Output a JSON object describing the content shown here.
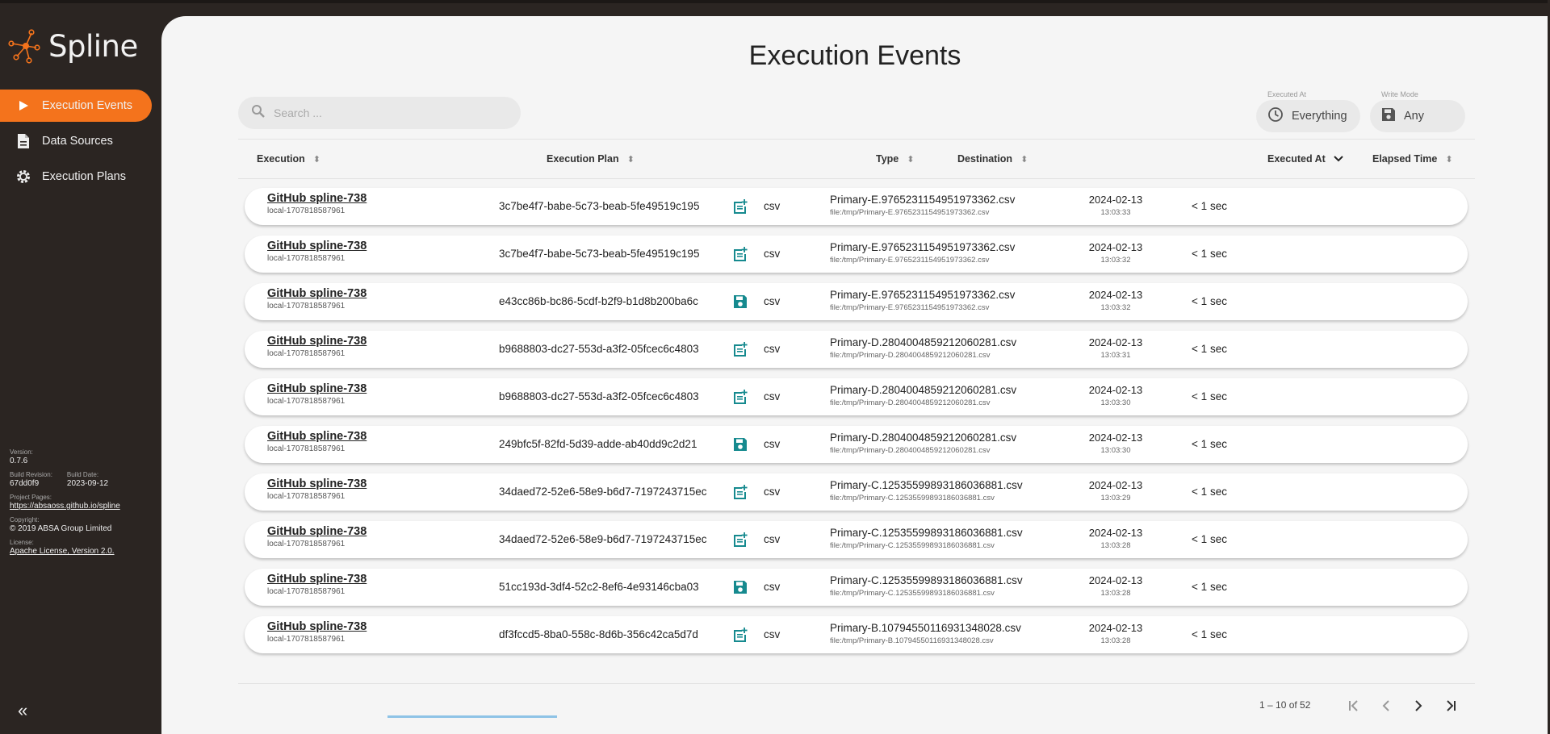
{
  "app": {
    "name": "Spline"
  },
  "colors": {
    "accent": "#f4731c",
    "sidebar": "#2b2522",
    "teal": "#168a8f"
  },
  "nav": [
    {
      "label": "Execution Events",
      "icon": "play-icon",
      "active": true
    },
    {
      "label": "Data Sources",
      "icon": "document-icon",
      "active": false
    },
    {
      "label": "Execution Plans",
      "icon": "gear-icon",
      "active": false
    }
  ],
  "sidebar_info": {
    "version_label": "Version:",
    "version": "0.7.6",
    "build_revision_label": "Build Revision:",
    "build_revision": "67dd0f9",
    "build_date_label": "Build Date:",
    "build_date": "2023-09-12",
    "project_pages_label": "Project Pages:",
    "project_pages": "https://absaoss.github.io/spline",
    "copyright_label": "Copyright:",
    "copyright": "© 2019 ABSA Group Limited",
    "license_label": "License:",
    "license": "Apache License, Version 2.0.",
    "collapse": "«"
  },
  "page": {
    "title": "Execution Events"
  },
  "search": {
    "placeholder": "Search ..."
  },
  "filters": {
    "executed_at": {
      "label": "Executed At",
      "value": "Everything"
    },
    "write_mode": {
      "label": "Write Mode",
      "value": "Any"
    }
  },
  "table": {
    "headers": {
      "execution": "Execution",
      "execution_plan": "Execution Plan",
      "type": "Type",
      "destination": "Destination",
      "executed_at": "Executed At",
      "elapsed_time": "Elapsed Time"
    },
    "rows": [
      {
        "name": "GitHub spline-738",
        "sub": "local-1707818587961",
        "plan": "3c7be4f7-babe-5c73-beab-5fe49519c195",
        "mode": "append",
        "type": "csv",
        "dest": "Primary-E.9765231154951973362.csv",
        "dest_path": "file:/tmp/Primary-E.9765231154951973362.csv",
        "date": "2024-02-13",
        "time": "13:03:33",
        "elapsed": "< 1 sec"
      },
      {
        "name": "GitHub spline-738",
        "sub": "local-1707818587961",
        "plan": "3c7be4f7-babe-5c73-beab-5fe49519c195",
        "mode": "append",
        "type": "csv",
        "dest": "Primary-E.9765231154951973362.csv",
        "dest_path": "file:/tmp/Primary-E.9765231154951973362.csv",
        "date": "2024-02-13",
        "time": "13:03:32",
        "elapsed": "< 1 sec"
      },
      {
        "name": "GitHub spline-738",
        "sub": "local-1707818587961",
        "plan": "e43cc86b-bc86-5cdf-b2f9-b1d8b200ba6c",
        "mode": "overwrite",
        "type": "csv",
        "dest": "Primary-E.9765231154951973362.csv",
        "dest_path": "file:/tmp/Primary-E.9765231154951973362.csv",
        "date": "2024-02-13",
        "time": "13:03:32",
        "elapsed": "< 1 sec"
      },
      {
        "name": "GitHub spline-738",
        "sub": "local-1707818587961",
        "plan": "b9688803-dc27-553d-a3f2-05fcec6c4803",
        "mode": "append",
        "type": "csv",
        "dest": "Primary-D.2804004859212060281.csv",
        "dest_path": "file:/tmp/Primary-D.2804004859212060281.csv",
        "date": "2024-02-13",
        "time": "13:03:31",
        "elapsed": "< 1 sec"
      },
      {
        "name": "GitHub spline-738",
        "sub": "local-1707818587961",
        "plan": "b9688803-dc27-553d-a3f2-05fcec6c4803",
        "mode": "append",
        "type": "csv",
        "dest": "Primary-D.2804004859212060281.csv",
        "dest_path": "file:/tmp/Primary-D.2804004859212060281.csv",
        "date": "2024-02-13",
        "time": "13:03:30",
        "elapsed": "< 1 sec"
      },
      {
        "name": "GitHub spline-738",
        "sub": "local-1707818587961",
        "plan": "249bfc5f-82fd-5d39-adde-ab40dd9c2d21",
        "mode": "overwrite",
        "type": "csv",
        "dest": "Primary-D.2804004859212060281.csv",
        "dest_path": "file:/tmp/Primary-D.2804004859212060281.csv",
        "date": "2024-02-13",
        "time": "13:03:30",
        "elapsed": "< 1 sec"
      },
      {
        "name": "GitHub spline-738",
        "sub": "local-1707818587961",
        "plan": "34daed72-52e6-58e9-b6d7-7197243715ec",
        "mode": "append",
        "type": "csv",
        "dest": "Primary-C.12535599893186036881.csv",
        "dest_path": "file:/tmp/Primary-C.12535599893186036881.csv",
        "date": "2024-02-13",
        "time": "13:03:29",
        "elapsed": "< 1 sec"
      },
      {
        "name": "GitHub spline-738",
        "sub": "local-1707818587961",
        "plan": "34daed72-52e6-58e9-b6d7-7197243715ec",
        "mode": "append",
        "type": "csv",
        "dest": "Primary-C.12535599893186036881.csv",
        "dest_path": "file:/tmp/Primary-C.12535599893186036881.csv",
        "date": "2024-02-13",
        "time": "13:03:28",
        "elapsed": "< 1 sec"
      },
      {
        "name": "GitHub spline-738",
        "sub": "local-1707818587961",
        "plan": "51cc193d-3df4-52c2-8ef6-4e93146cba03",
        "mode": "overwrite",
        "type": "csv",
        "dest": "Primary-C.12535599893186036881.csv",
        "dest_path": "file:/tmp/Primary-C.12535599893186036881.csv",
        "date": "2024-02-13",
        "time": "13:03:28",
        "elapsed": "< 1 sec"
      },
      {
        "name": "GitHub spline-738",
        "sub": "local-1707818587961",
        "plan": "df3fccd5-8ba0-558c-8d6b-356c42ca5d7d",
        "mode": "append",
        "type": "csv",
        "dest": "Primary-B.10794550116931348028.csv",
        "dest_path": "file:/tmp/Primary-B.10794550116931348028.csv",
        "date": "2024-02-13",
        "time": "13:03:28",
        "elapsed": "< 1 sec"
      }
    ]
  },
  "pagination": {
    "range": "1 – 10 of 52"
  }
}
